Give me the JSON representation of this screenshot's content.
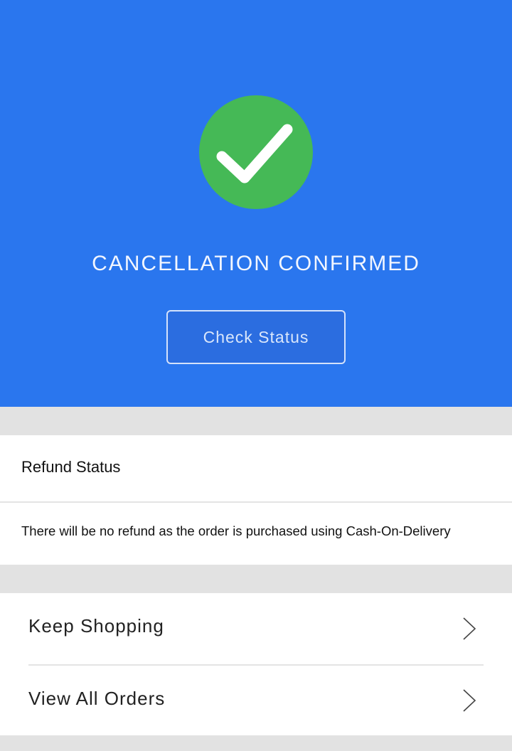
{
  "hero": {
    "title": "CANCELLATION CONFIRMED",
    "status_button_label": "Check Status",
    "background_color": "#2a76ee",
    "check_color": "#45b956",
    "icon": "checkmark-icon"
  },
  "refund": {
    "title": "Refund Status",
    "message": "There will be no refund as the order is purchased using Cash-On-Delivery"
  },
  "actions": [
    {
      "label": "Keep Shopping",
      "icon": "chevron-right-icon"
    },
    {
      "label": "View All Orders",
      "icon": "chevron-right-icon"
    }
  ]
}
